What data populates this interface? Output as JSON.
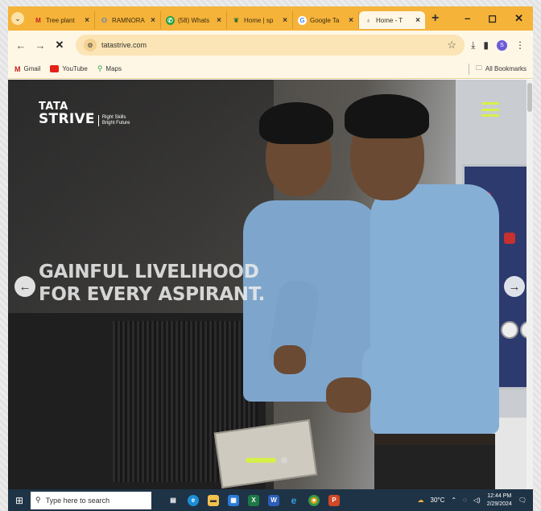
{
  "browser": {
    "tabs": [
      {
        "title": "Tree plant",
        "favicon": "gmail-icon",
        "color": "#c5221f"
      },
      {
        "title": "RAMNORA",
        "favicon": "people-icon",
        "color": "#3b6fd8"
      },
      {
        "title": "(58) Whats",
        "favicon": "whatsapp-icon",
        "color": "#25a244"
      },
      {
        "title": "Home | sp",
        "favicon": "leaf-icon",
        "color": "#2d6b2d"
      },
      {
        "title": "Google Ta",
        "favicon": "google-icon",
        "color": "#4285f4"
      },
      {
        "title": "Home - T",
        "favicon": "strive-icon",
        "color": "#333333",
        "active": true
      }
    ],
    "new_tab_symbol": "+",
    "window_controls": {
      "minimize": "–",
      "maximize": "◻",
      "close": "✕"
    },
    "url": "tatastrive.com",
    "bookmarks": [
      {
        "label": "Gmail",
        "icon": "gmail-icon"
      },
      {
        "label": "YouTube",
        "icon": "youtube-icon"
      },
      {
        "label": "Maps",
        "icon": "maps-icon"
      }
    ],
    "all_bookmarks": "All Bookmarks",
    "profile_letter": "S"
  },
  "site": {
    "brand_top": "TATA",
    "brand_main": "STRIVE",
    "tagline_1": "Right Skills",
    "tagline_2": "Bright Future",
    "hero_line_1": "GAINFUL LIVELIHOOD",
    "hero_line_2": "FOR EVERY ASPIRANT.",
    "accent": "#d6f04a",
    "prev_symbol": "←",
    "next_symbol": "→"
  },
  "taskbar": {
    "search_placeholder": "Type here to search",
    "temperature": "30°C",
    "time": "12:44 PM",
    "date": "2/29/2024"
  }
}
